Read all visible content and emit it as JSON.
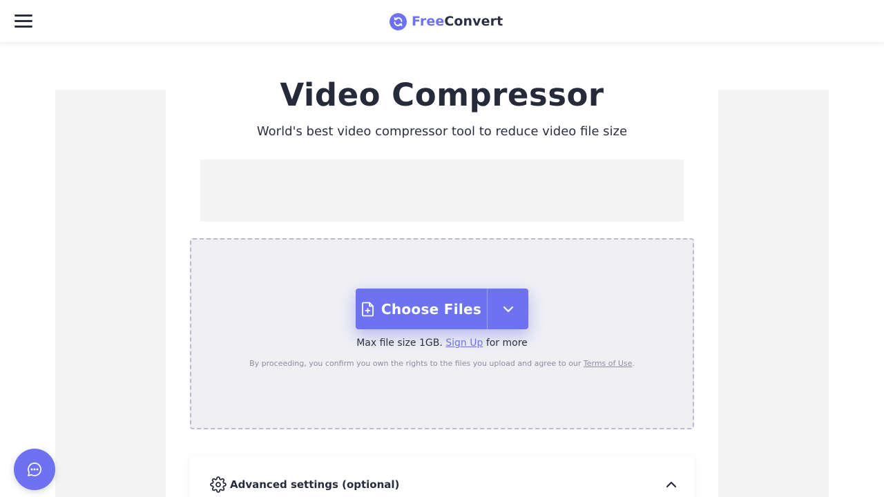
{
  "header": {
    "logo": {
      "free": "Free",
      "convert": "Convert"
    }
  },
  "main": {
    "title": "Video Compressor",
    "subtitle": "World's best video compressor tool to reduce video file size"
  },
  "upload": {
    "choose_label": "Choose Files",
    "max_prefix": "Max file size 1GB.",
    "signup_link": "Sign Up",
    "max_suffix": "for more",
    "legal_prefix": "By proceeding, you confirm you own the rights to the files you upload and agree to our",
    "terms_link": "Terms of Use",
    "legal_suffix": "."
  },
  "advanced": {
    "label": "Advanced settings (optional)"
  },
  "colors": {
    "accent": "#6c72f0",
    "text_dark": "#252b3b",
    "dropzone_bg": "#efeff4",
    "dropzone_border": "#bdb9d4",
    "ad_bg": "#f4f4f5"
  },
  "icons": {
    "menu": "hamburger-menu-icon",
    "logo": "refresh-circle-icon",
    "file": "file-plus-icon",
    "dropdown": "chevron-down-icon",
    "settings": "gear-icon",
    "collapse": "chevron-up-icon",
    "chat": "chat-bubble-icon"
  }
}
